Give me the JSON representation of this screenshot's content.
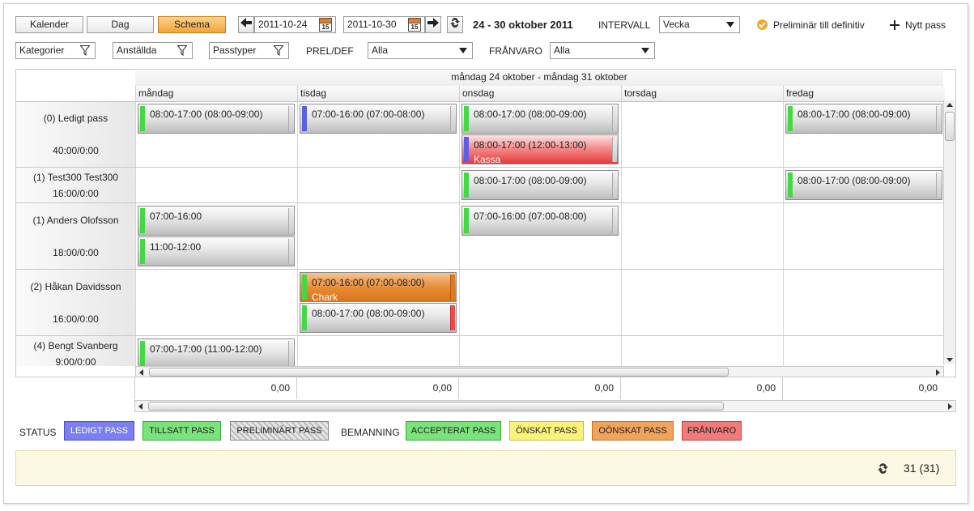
{
  "toolbar": {
    "view_tabs": [
      "Kalender",
      "Dag",
      "Schema"
    ],
    "active_tab": "Schema",
    "date_from": "2011-10-24",
    "date_to": "2011-10-30",
    "calendar_day": "15",
    "period_title": "24  - 30 oktober 2011",
    "interval_label": "INTERVALL",
    "interval_value": "Vecka",
    "preliminary_label": "Preliminär till definitiv",
    "new_shift_label": "Nytt pass"
  },
  "filters": {
    "kategorier": "Kategorier",
    "anstallda": "Anställda",
    "passtyper": "Passtyper",
    "preldef_label": "PREL/DEF",
    "preldef_value": "Alla",
    "franvaro_label": "FRÅNVARO",
    "franvaro_value": "Alla"
  },
  "grid": {
    "range_header": "måndag 24 oktober  -  måndag 31 oktober",
    "days": [
      "måndag",
      "tisdag",
      "onsdag",
      "torsdag",
      "fredag"
    ],
    "rows": [
      {
        "name": "(0) Ledigt pass",
        "hours": "40:00/0:00"
      },
      {
        "name": "(1) Test300 Test300",
        "hours": "16:00/0:00"
      },
      {
        "name": "(1) Anders Olofsson",
        "hours": "18:00/0:00"
      },
      {
        "name": "(2) Håkan Davidsson",
        "hours": "16:00/0:00"
      },
      {
        "name": "(4) Bengt Svanberg",
        "hours": "9:00/0:00"
      }
    ],
    "shifts": [
      {
        "text": "08:00-17:00 (08:00-09:00)"
      },
      {
        "text": "07:00-16:00 (07:00-08:00)"
      },
      {
        "text": "08:00-17:00 (08:00-09:00)"
      },
      {
        "text": "08:00-17:00 (12:00-13:00)",
        "sub": "Kassa"
      },
      {
        "text": "08:00-17:00 (08:00-09:00)"
      },
      {
        "text": "08:00-17:00 (08:00-09:00)"
      },
      {
        "text": "08:00-17:00 (08:00-09:00)"
      },
      {
        "text": "07:00-16:00"
      },
      {
        "text": "11:00-12:00"
      },
      {
        "text": "07:00-16:00 (07:00-08:00)"
      },
      {
        "text": "07:00-16:00 (07:00-08:00)",
        "sub": "Chark"
      },
      {
        "text": "08:00-17:00 (08:00-09:00)"
      },
      {
        "text": "07:00-17:00 (11:00-12:00)"
      }
    ],
    "totals": [
      "0,00",
      "0,00",
      "0,00",
      "0,00",
      "0,00"
    ]
  },
  "legend": {
    "status_label": "STATUS",
    "bemanning_label": "BEMANNING",
    "items": [
      "LEDIGT PASS",
      "TILLSATT PASS",
      "PRELIMINÄRT PASS",
      "ACCEPTERAT PASS",
      "ÖNSKAT PASS",
      "OÖNSKAT PASS",
      "FRÅNVARO"
    ],
    "colors": {
      "ledigt": "#7b7ff2",
      "tillsatt": "#7be37b",
      "preliminart": "#d8d8d8",
      "accepterat": "#7be37b",
      "onskat": "#fbf27b",
      "oonskat": "#f0a35a",
      "franvaro": "#f17a7a"
    }
  },
  "footer": {
    "count": "31 (31)"
  }
}
